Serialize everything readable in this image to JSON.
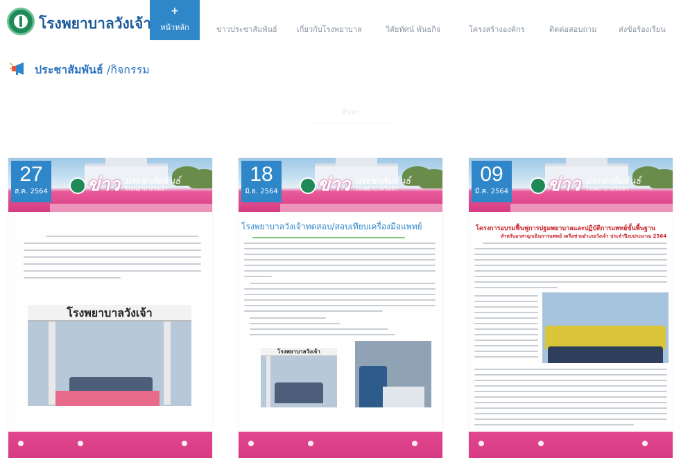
{
  "header": {
    "site_title": "โรงพยาบาลวังเจ้า",
    "nav": {
      "home_icon": "plus-icon",
      "home_label": "หน้าหลัก",
      "items": [
        "ข่าวประชาสัมพันธ์",
        "เกี่ยวกับโรงพยาบาล",
        "วิสัยทัศน์ พันธกิจ",
        "โครงสร้างองค์กร",
        "ติดต่อสอบถาม",
        "ส่งข้อร้องเรียน"
      ]
    }
  },
  "section": {
    "icon": "megaphone-icon",
    "title": "ประชาสัมพันธ์",
    "subtitle": " /กิจกรรม"
  },
  "search": {
    "label": "ค้นหา"
  },
  "cards": [
    {
      "day": "27",
      "month": "ส.ค. 2564",
      "news_word": "ข่าว",
      "news_sub": "ประชาสัมพันธ์",
      "news_sub2": "โรงพยาบาลวังเจ้า",
      "photo_sign": "โรงพยาบาลวังเจ้า"
    },
    {
      "day": "18",
      "month": "มิ.ย. 2564",
      "news_word": "ข่าว",
      "news_sub": "ประชาสัมพันธ์",
      "news_sub2": "โรงพยาบาลวังเจ้า",
      "headline": "โรงพยาบาลวังเจ้าทดสอบ/สอบเทียบเครื่องมือแพทย์",
      "photo_sign": "โรงพยาบาลวังเจ้า"
    },
    {
      "day": "09",
      "month": "มี.ค. 2564",
      "news_word": "ข่าว",
      "news_sub": "ประชาสัมพันธ์",
      "news_sub2": "โรงพยาบาลวังเจ้า",
      "headline": "โครงการอบรมฟื้นฟูการปฐมพยาบาลและปฏิบัติการแพทย์ขั้นพื้นฐาน",
      "subhead": "สำหรับอาสาฉุกเฉินการแพทย์ เครือข่ายอำเภอวังเจ้า ประจำปีงบประมาณ 2564"
    }
  ],
  "colors": {
    "brand_blue": "#2f86c8",
    "title_blue": "#1a5a9a",
    "banner_pink": "#d63b83"
  }
}
